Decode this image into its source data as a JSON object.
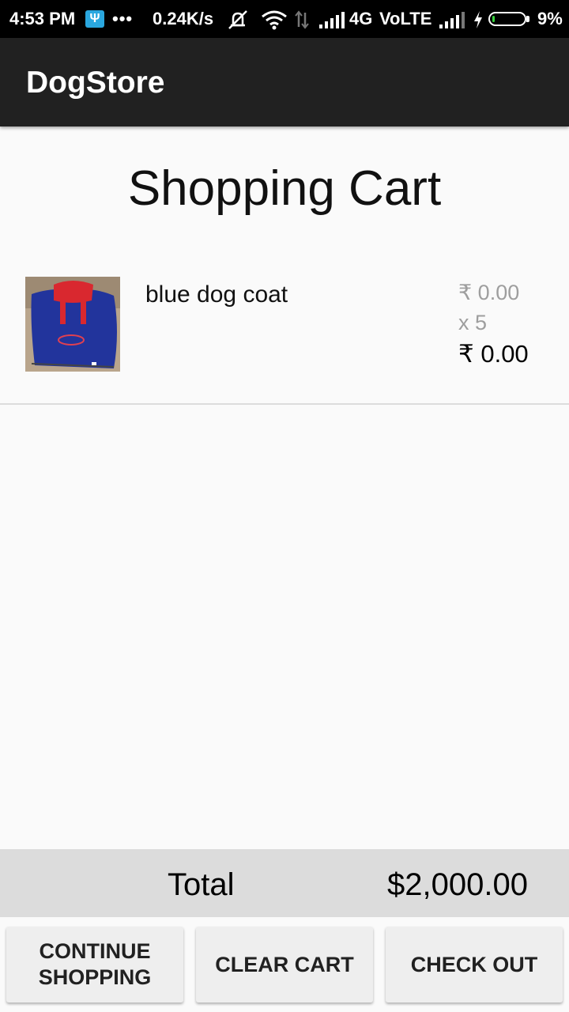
{
  "status_bar": {
    "time": "4:53 PM",
    "usb_glyph": "Ψ",
    "dots": "•••",
    "speed": "0.24K/s",
    "network": "4G",
    "volte": "VoLTE",
    "battery_pct": "9%",
    "battery_level": 0.09,
    "icons": [
      "usb-debug-icon",
      "muted-vibrate-icon",
      "wifi-icon",
      "data-arrows-icon",
      "signal-icon",
      "signal-icon-2",
      "charging-icon",
      "battery-icon"
    ]
  },
  "app_bar": {
    "title": "DogStore"
  },
  "page": {
    "title": "Shopping Cart"
  },
  "cart": {
    "items": [
      {
        "name": "blue dog coat",
        "unit_price": "₹ 0.00",
        "quantity": "x 5",
        "line_total": "₹ 0.00",
        "image": "blue-dog-coat-photo"
      }
    ]
  },
  "total": {
    "label": "Total",
    "value": "$2,000.00"
  },
  "buttons": {
    "continue_line1": "CONTINUE",
    "continue_line2": "SHOPPING",
    "clear": "CLEAR CART",
    "checkout": "CHECK OUT"
  },
  "colors": {
    "app_bar": "#212121",
    "status_bar": "#000000",
    "background": "#fafafa",
    "total_bar": "#dcdcdc",
    "button": "#eeeeee",
    "battery_fill": "#35d33b"
  }
}
